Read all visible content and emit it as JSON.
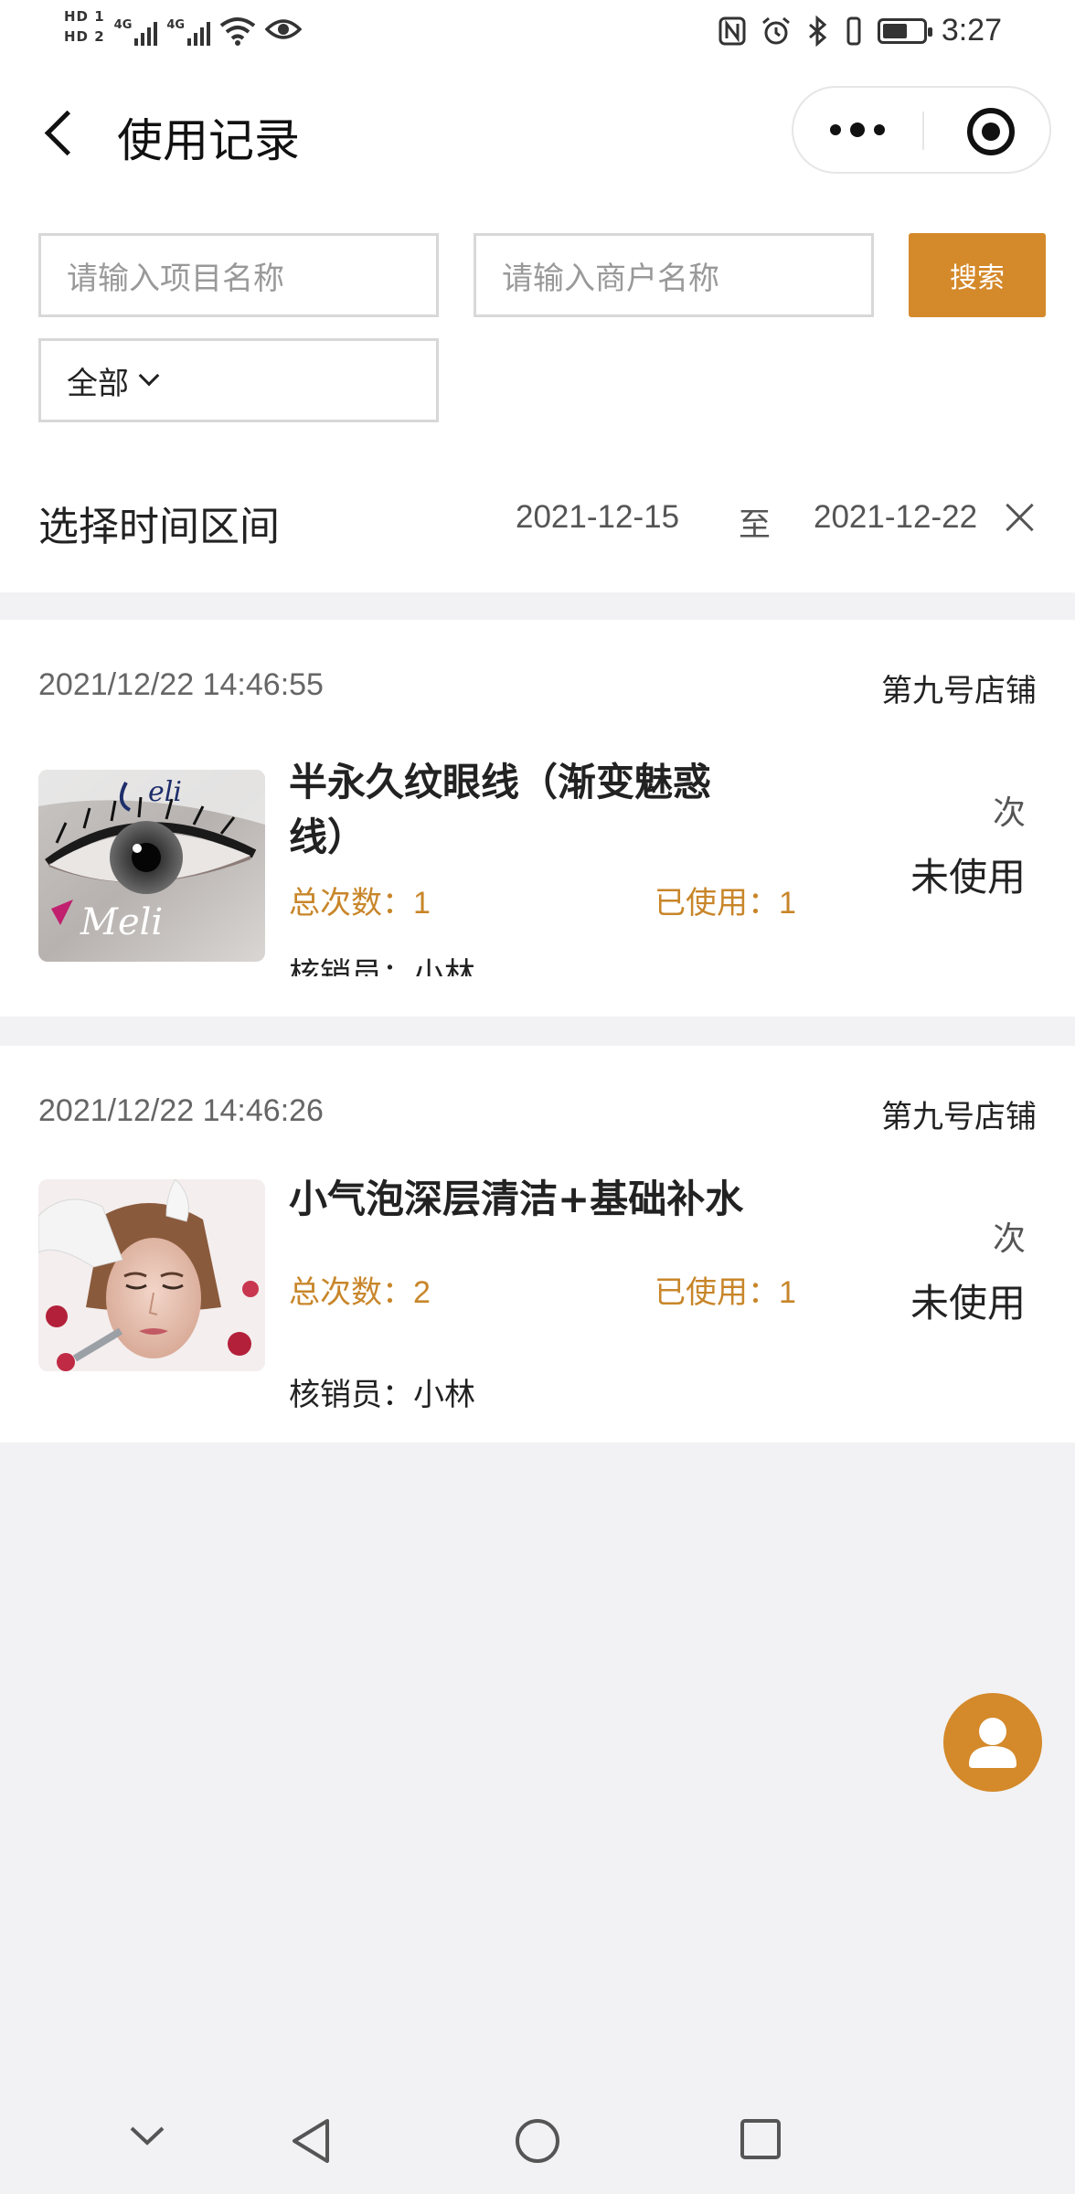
{
  "status_bar": {
    "hd1": "HD 1",
    "hd2": "HD 2",
    "net1": "4G",
    "net2": "4G",
    "time": "3:27",
    "battery_level": 0.62
  },
  "nav": {
    "title": "使用记录"
  },
  "filters": {
    "project_placeholder": "请输入项目名称",
    "merchant_placeholder": "请输入商户名称",
    "search_label": "搜索",
    "select_value": "全部",
    "range_label": "选择时间区间",
    "range_start": "2021-12-15",
    "range_sep": "至",
    "range_end": "2021-12-22"
  },
  "records": [
    {
      "time": "2021/12/22 14:46:55",
      "shop": "第九号店铺",
      "title": "半永久纹眼线（渐变魅惑线）",
      "total_label": "总次数：",
      "total": "1",
      "used_label": "已使用：",
      "used": "1",
      "operator_label": "核销员：",
      "operator": "小林",
      "unit": "次",
      "status": "未使用",
      "thumb_text": "eli",
      "thumb_text2": "Meli"
    },
    {
      "time": "2021/12/22 14:46:26",
      "shop": "第九号店铺",
      "title": "小气泡深层清洁+基础补水",
      "total_label": "总次数：",
      "total": "2",
      "used_label": "已使用：",
      "used": "1",
      "operator_label": "核销员：",
      "operator": "小林",
      "unit": "次",
      "status": "未使用"
    }
  ],
  "colors": {
    "accent": "#d4892a",
    "stat_text": "#c8862a",
    "background": "#f2f2f4"
  },
  "icons": {
    "back": "chevron-left-icon",
    "more": "more-dots-icon",
    "close": "target-close-icon",
    "dropdown": "chevron-down-icon",
    "clear": "close-icon",
    "fab": "user-icon"
  }
}
